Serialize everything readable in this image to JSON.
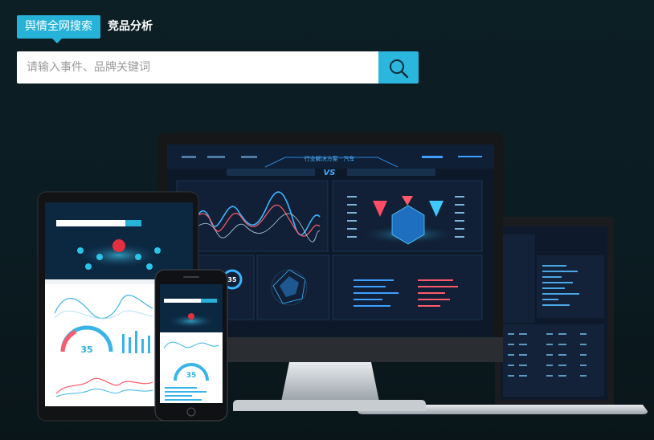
{
  "tabs": {
    "active_label": "舆情全网搜索",
    "second_label": "竞品分析"
  },
  "search": {
    "placeholder": "请输入事件、品牌关键词"
  },
  "monitor": {
    "title": "行业解决方案 · 汽车",
    "vs_label": "VS"
  },
  "gauge": {
    "value": "35"
  },
  "phone": {
    "gauge_value": "35"
  },
  "tablet": {
    "gauge_value": "35"
  },
  "colors": {
    "accent": "#27b3d8",
    "background": "#0c1f25"
  }
}
